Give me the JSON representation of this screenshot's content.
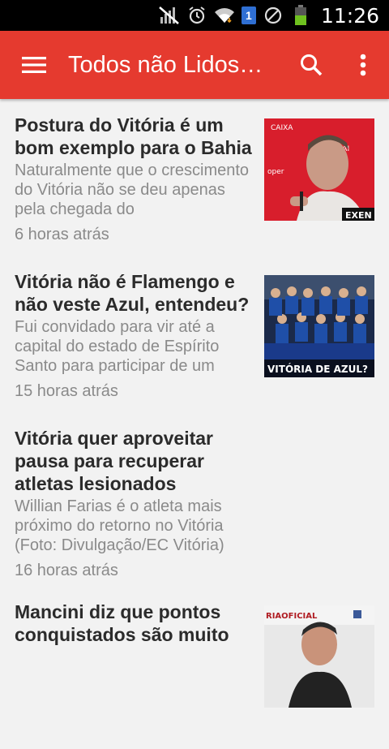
{
  "status_bar": {
    "time": "11:26",
    "sim_slot": "1",
    "icons": [
      "no-signal-icon",
      "alarm-icon",
      "wifi-icon",
      "sim-icon",
      "blocked-icon",
      "battery-icon"
    ]
  },
  "app_bar": {
    "title": "Todos não Lidos…",
    "background": "#e53a2f",
    "icons": [
      "menu-icon",
      "search-icon",
      "overflow-menu-icon"
    ]
  },
  "articles": [
    {
      "title": "Postura do Vitória é um bom exemplo para o Bahia",
      "snippet": "Naturalmente que o crescimento do Vitória não se deu apenas pela chegada do",
      "time": "6 horas atrás",
      "thumb_caption": "EXEN"
    },
    {
      "title": "Vitória não é Flamengo e não veste Azul, entendeu?",
      "snippet": "Fui convidado para vir até a capital do estado de Espírito Santo para participar de um",
      "time": "15 horas atrás",
      "thumb_caption": "VITÓRIA DE AZUL?"
    },
    {
      "title": "Vitória quer aproveitar pausa para recuperar atletas lesionados",
      "snippet": "Willian Farias é o atleta mais próximo do retorno no Vitória (Foto: Divulgação/EC Vitória)",
      "time": "16 horas atrás",
      "thumb_caption": ""
    },
    {
      "title": "Mancini diz que pontos conquistados são muito",
      "snippet": "",
      "time": "",
      "thumb_caption": "RIAOFICIAL"
    }
  ]
}
